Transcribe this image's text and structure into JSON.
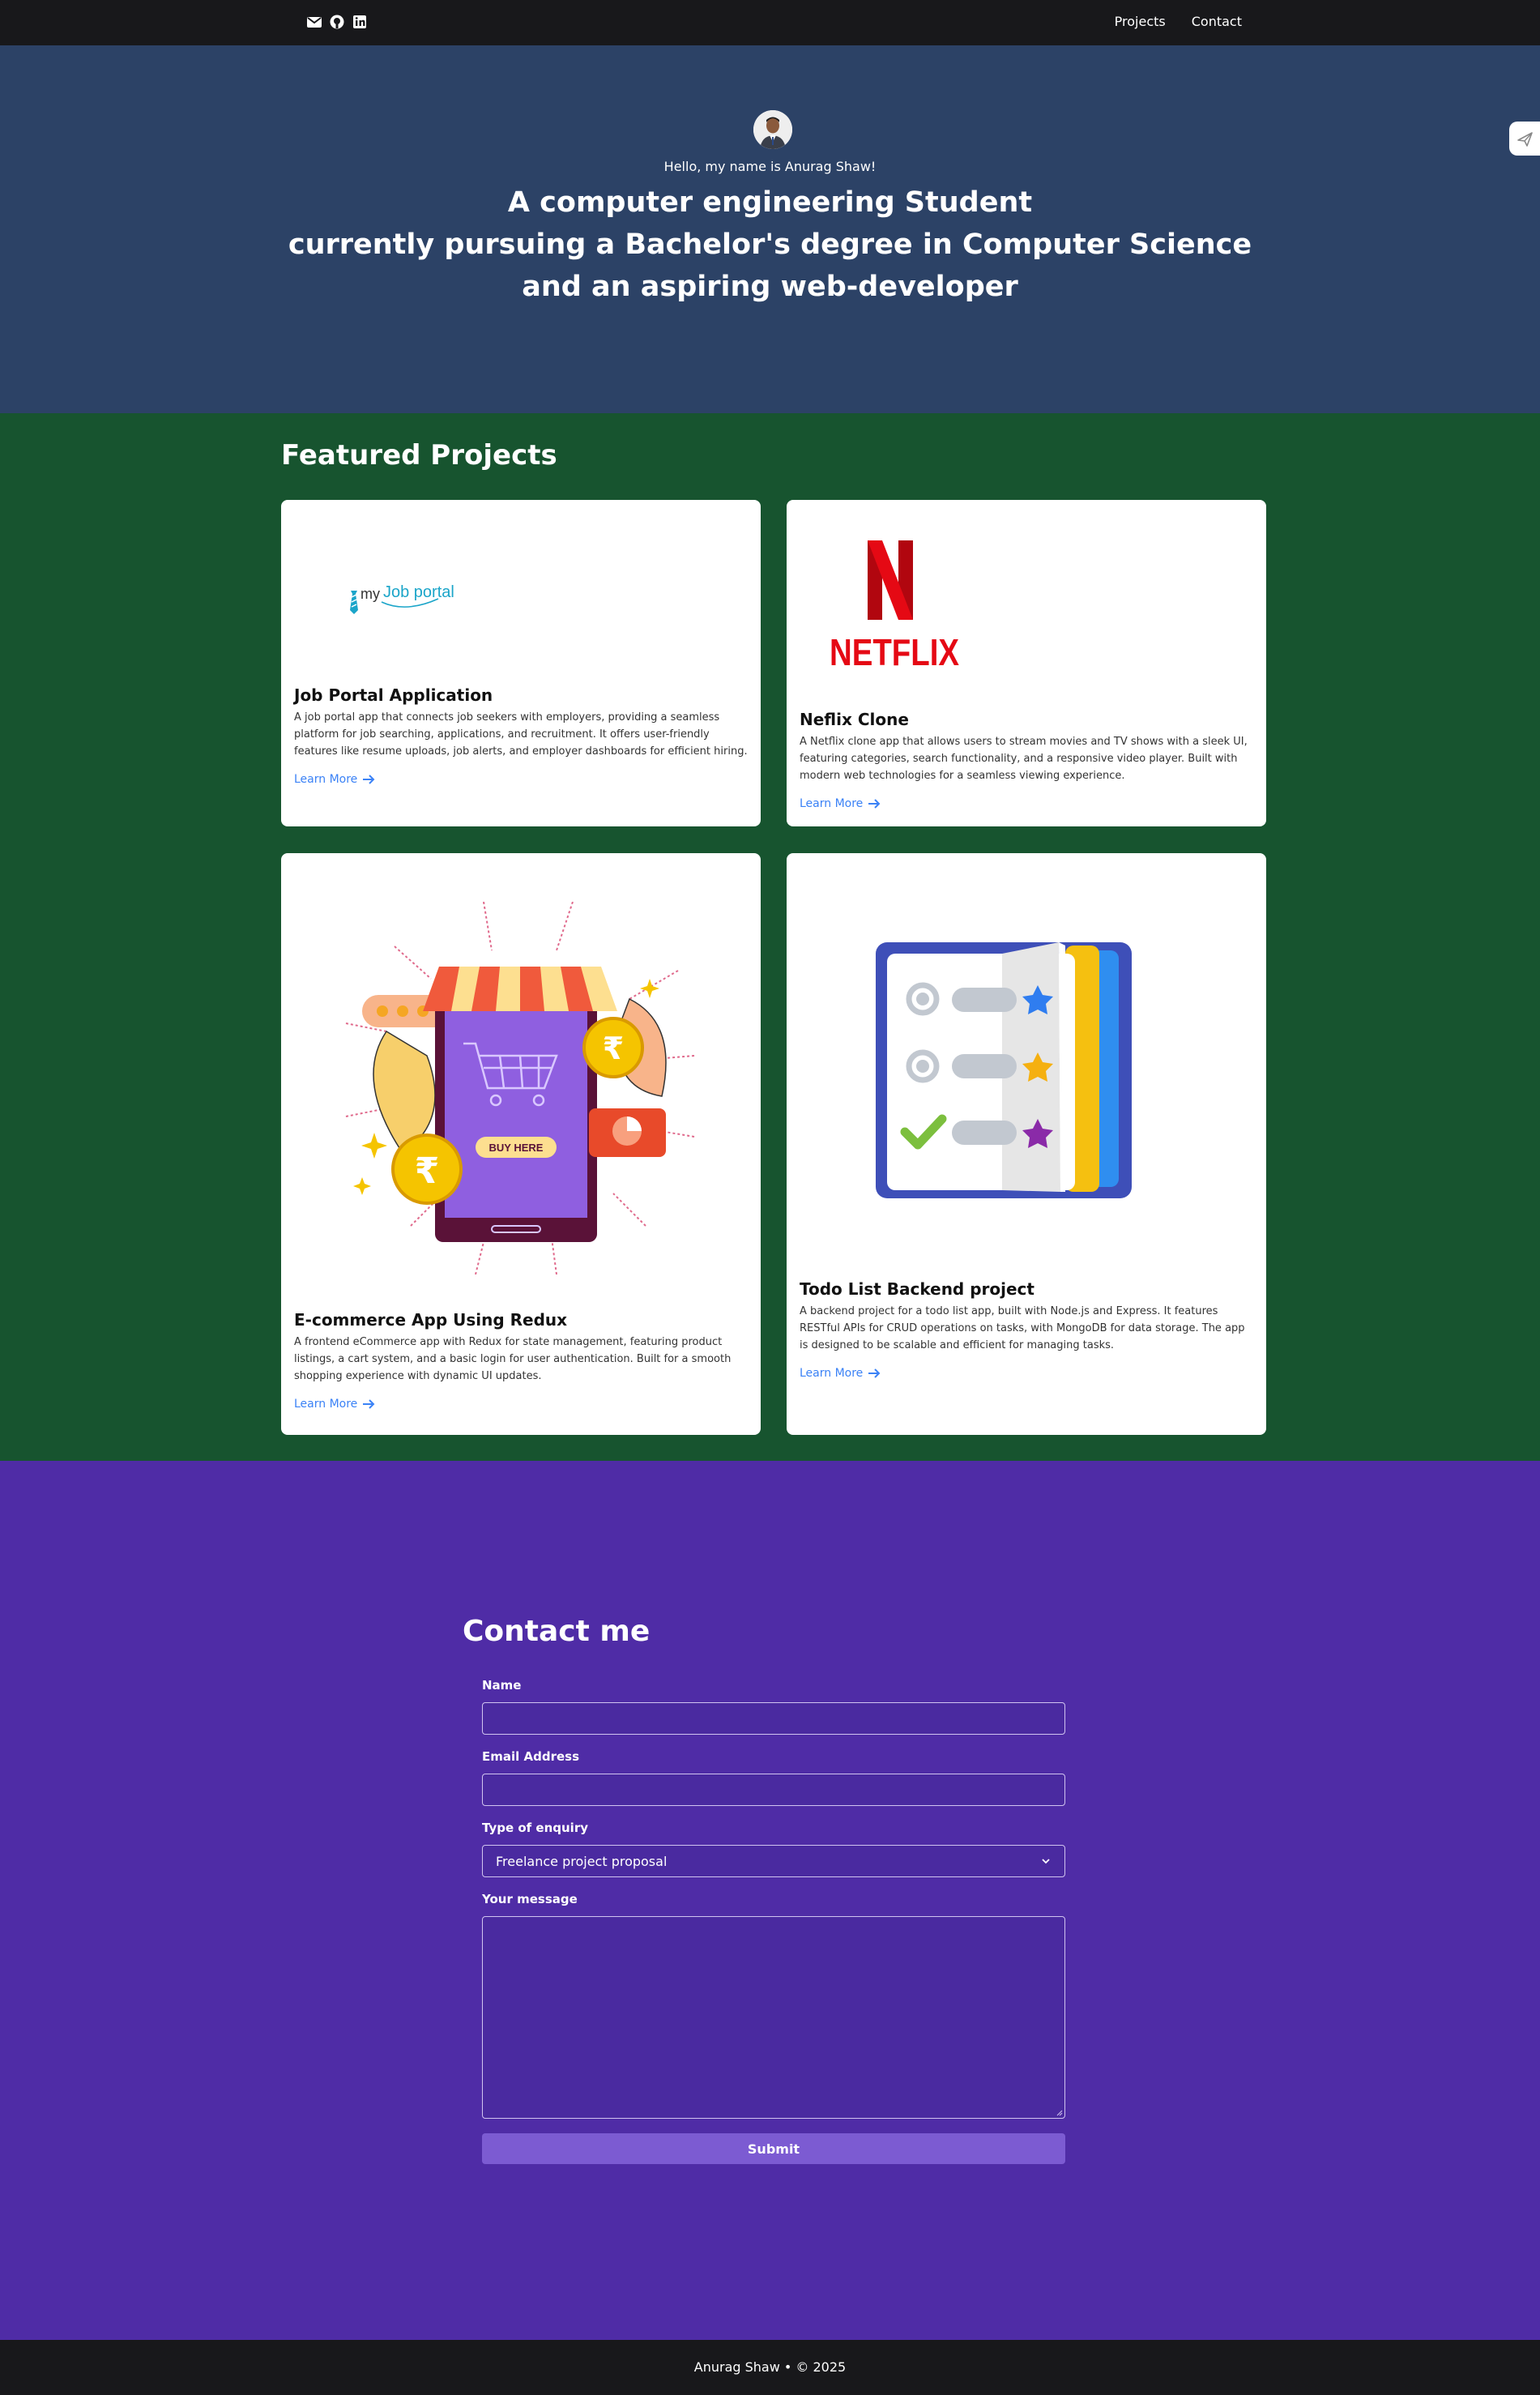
{
  "nav": {
    "icons": [
      "envelope-icon",
      "github-icon",
      "linkedin-icon"
    ],
    "links": [
      "Projects",
      "Contact"
    ]
  },
  "hero": {
    "greeting": "Hello, my name is Anurag Shaw!",
    "headline": [
      "A computer engineering Student",
      "currently pursuing a Bachelor's degree in Computer Science",
      "and an aspiring web-developer"
    ]
  },
  "projects": {
    "title": "Featured Projects",
    "items": [
      {
        "title": "Job Portal Application",
        "logo_text_a": "my",
        "logo_text_b": "Job portal",
        "description": "A job portal app that connects job seekers with employers, providing a seamless platform for job searching, applications, and recruitment. It offers user-friendly features like resume uploads, job alerts, and employer dashboards for efficient hiring.",
        "link": "Learn More"
      },
      {
        "title": "Neflix Clone",
        "logo_text": "NETFLIX",
        "description": "A Netflix clone app that allows users to stream movies and TV shows with a sleek UI, featuring categories, search functionality, and a responsive video player. Built with modern web technologies for a seamless viewing experience.",
        "link": "Learn More"
      },
      {
        "title": "E-commerce App Using Redux",
        "illustration_text": "BUY HERE",
        "description": "A frontend eCommerce app with Redux for state management, featuring product listings, a cart system, and a basic login for user authentication. Built for a smooth shopping experience with dynamic UI updates.",
        "link": "Learn More"
      },
      {
        "title": "Todo List Backend project",
        "description": "A backend project for a todo list app, built with Node.js and Express. It features RESTful APIs for CRUD operations on tasks, with MongoDB for data storage. The app is designed to be scalable and efficient for managing tasks.",
        "link": "Learn More"
      }
    ]
  },
  "contact": {
    "title": "Contact me",
    "name_label": "Name",
    "email_label": "Email Address",
    "enquiry_label": "Type of enquiry",
    "enquiry_value": "Freelance project proposal",
    "message_label": "Your message",
    "submit": "Submit"
  },
  "footer": {
    "text": "Anurag Shaw • © 2025"
  },
  "colors": {
    "nav_bg": "#18181b",
    "hero_bg": "#2c4266",
    "projects_bg": "#17542f",
    "contact_bg": "#4f2ca6",
    "link": "#3b82f6",
    "submit_bg": "#7c5bd2"
  }
}
